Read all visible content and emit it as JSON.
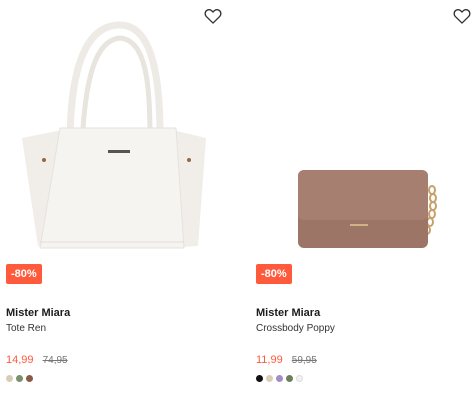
{
  "products": [
    {
      "brand": "Mister Miara",
      "name": "Tote Ren",
      "discount": "-80%",
      "price_now": "14,99",
      "price_old": "74,95",
      "swatches": [
        "#d8ccb6",
        "#7a8f6b",
        "#8a5a45"
      ],
      "wishlist_icon": "heart-outline-icon"
    },
    {
      "brand": "Mister Miara",
      "name": "Crossbody Poppy",
      "discount": "-80%",
      "price_now": "11,99",
      "price_old": "59,95",
      "swatches": [
        "#111111",
        "#d9cfb8",
        "#a48cc4",
        "#6b7f5d",
        "#f2f2f2"
      ],
      "wishlist_icon": "heart-outline-icon"
    }
  ],
  "colors": {
    "accent": "#ff5a3c"
  }
}
